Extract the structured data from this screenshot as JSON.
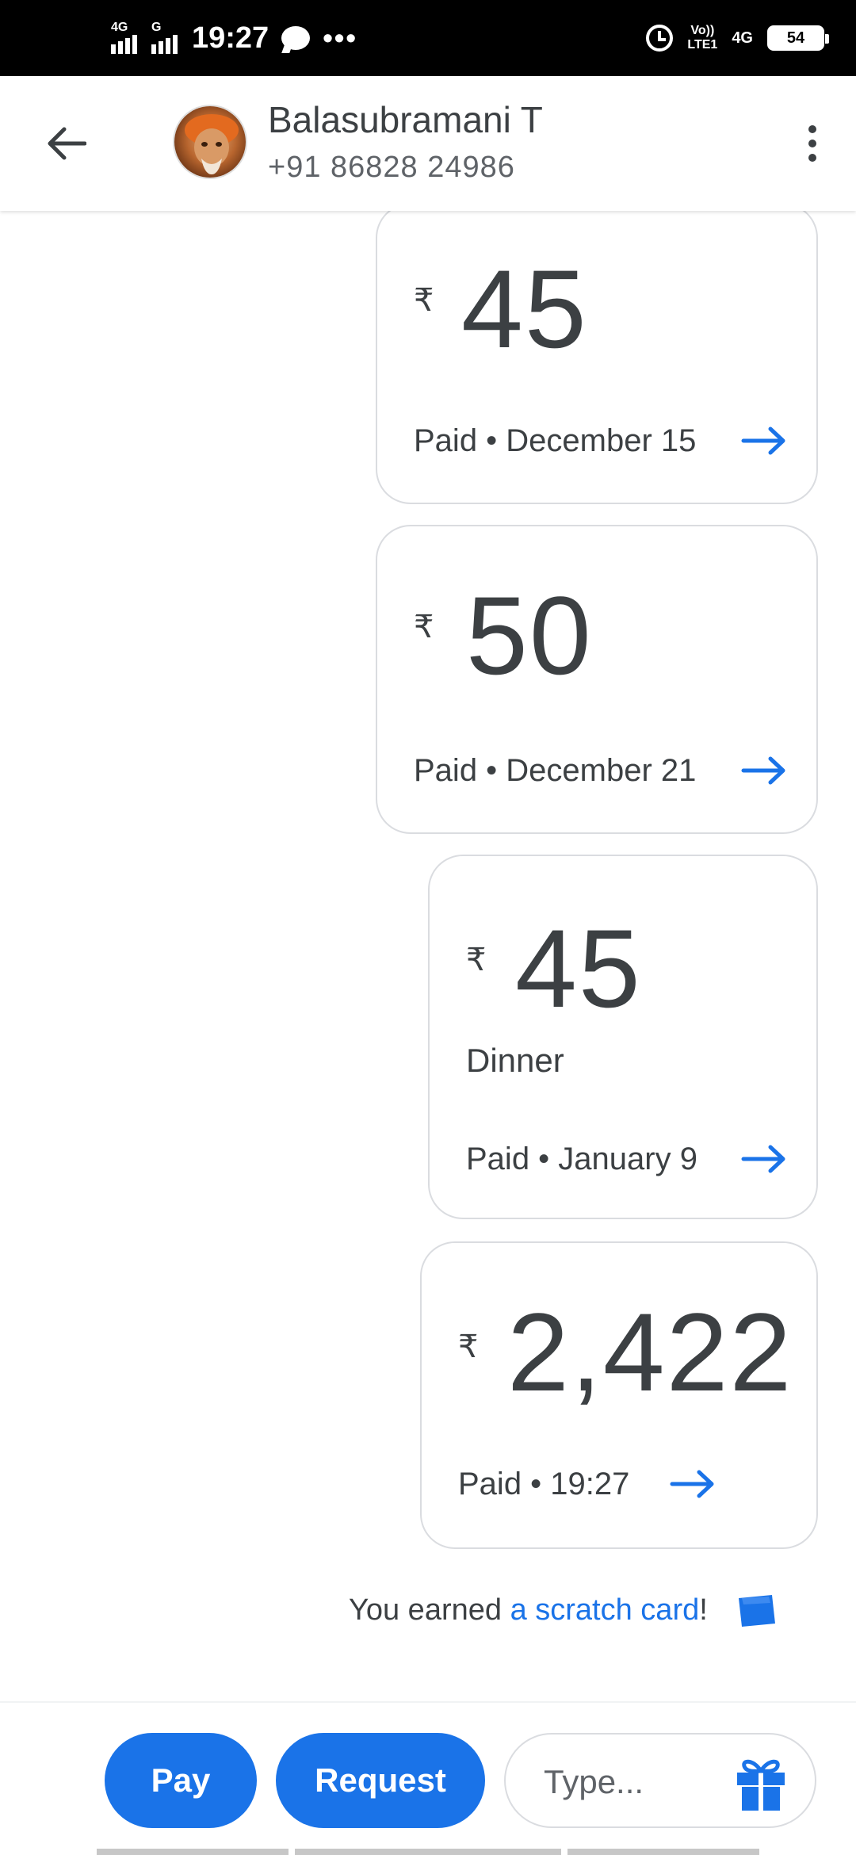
{
  "status_bar": {
    "network1": "4G",
    "network2": "G",
    "time": "19:27",
    "more": "•••",
    "volte_top": "Vo))",
    "volte_bottom": "LTE1",
    "network_right": "4G",
    "battery": "54"
  },
  "header": {
    "contact_name": "Balasubramani T",
    "contact_phone": "+91 86828 24986"
  },
  "transactions": [
    {
      "currency": "₹",
      "amount": "45",
      "note": "",
      "status": "Paid • December 15"
    },
    {
      "currency": "₹",
      "amount": "50",
      "note": "",
      "status": "Paid • December 21"
    },
    {
      "currency": "₹",
      "amount": "45",
      "note": "Dinner",
      "status": "Paid • January 9"
    },
    {
      "currency": "₹",
      "amount": "2,422",
      "note": "",
      "status": "Paid • 19:27"
    }
  ],
  "reward": {
    "prefix": "You earned ",
    "link": "a scratch card",
    "suffix": "!"
  },
  "bottom_bar": {
    "pay_label": "Pay",
    "request_label": "Request",
    "type_placeholder": "Type..."
  },
  "colors": {
    "accent": "#1a73e8",
    "text": "#3c4043",
    "border": "#dadce0"
  },
  "icons": [
    "back-arrow-icon",
    "more-vert-icon",
    "forward-arrow-icon",
    "scratch-card-icon",
    "gift-icon",
    "alarm-icon",
    "chat-icon"
  ]
}
